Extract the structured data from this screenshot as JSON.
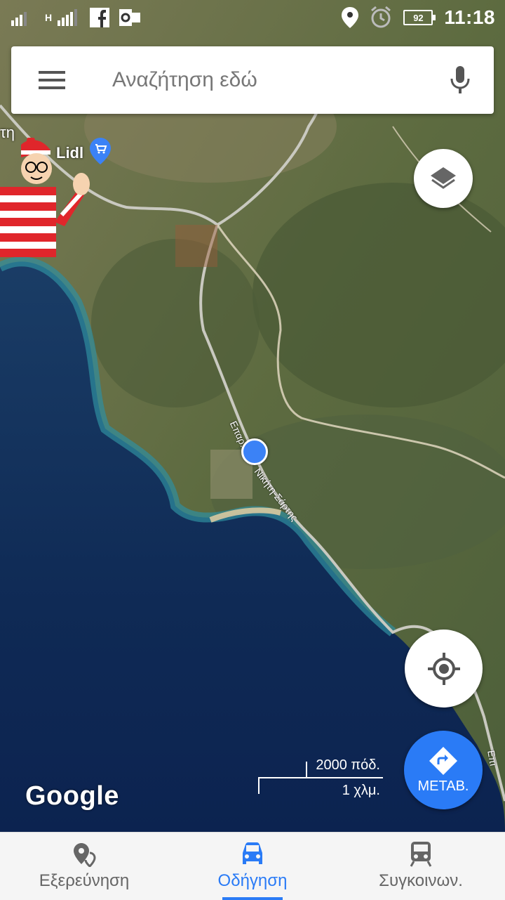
{
  "status_bar": {
    "network_label": "H",
    "battery": "92",
    "time": "11:18"
  },
  "search": {
    "placeholder": "Αναζήτηση εδώ"
  },
  "map": {
    "place_label": "τη",
    "poi_label": "Lidl",
    "road_label_a": "Επαρ.",
    "road_label_b": "Νικήτη-Σάρτης",
    "road_label_c": "Επι",
    "scale_top": "2000 πόδ.",
    "scale_bottom": "1 χλμ.",
    "logo": "Google"
  },
  "nav_button": {
    "label": "ΜΕΤΑΒ."
  },
  "bottom_nav": {
    "tabs": [
      {
        "label": "Εξερεύνηση",
        "icon": "explore-icon",
        "active": false
      },
      {
        "label": "Οδήγηση",
        "icon": "car-icon",
        "active": true
      },
      {
        "label": "Συγκοινων.",
        "icon": "train-icon",
        "active": false
      }
    ]
  },
  "colors": {
    "accent": "#2a7bf6",
    "sea_deep": "#0f2a55",
    "land": "#5a6b45"
  }
}
